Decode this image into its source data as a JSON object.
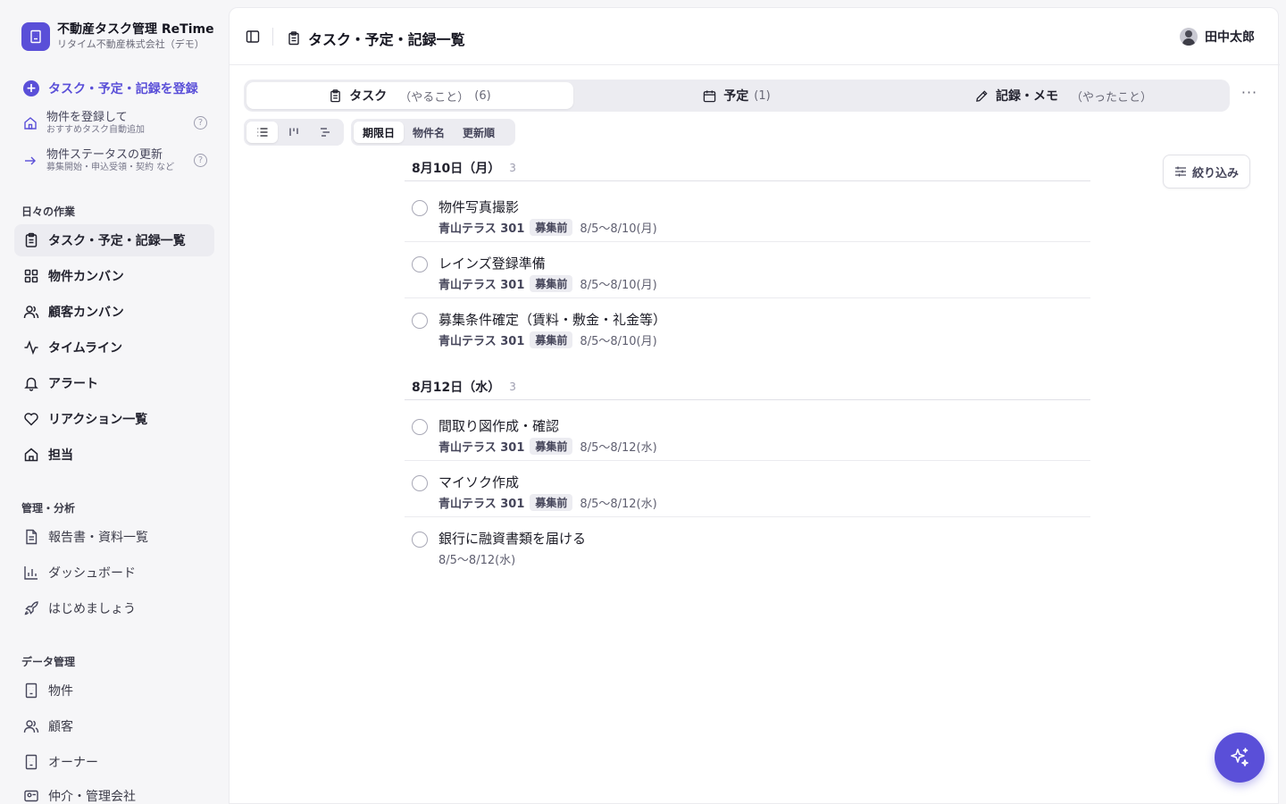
{
  "brand": {
    "title": "不動産タスク管理 ReTime",
    "subtitle": "リタイム不動産株式会社（デモ）"
  },
  "sidebar": {
    "primary_action": "タスク・予定・記録を登録",
    "helpers": [
      {
        "title": "物件を登録して",
        "sub": "おすすめタスク自動追加",
        "help": "?"
      },
      {
        "title": "物件ステータスの更新",
        "sub": "募集開始・申込受領・契約 など",
        "help": "?"
      }
    ],
    "sections": {
      "daily": "日々の作業",
      "admin": "管理・分析",
      "data": "データ管理"
    },
    "daily_items": [
      {
        "label": "タスク・予定・記録一覧",
        "icon": "clipboard-icon",
        "active": true
      },
      {
        "label": "物件カンバン",
        "icon": "grid-icon"
      },
      {
        "label": "顧客カンバン",
        "icon": "users-icon"
      },
      {
        "label": "タイムライン",
        "icon": "activity-icon"
      },
      {
        "label": "アラート",
        "icon": "bell-icon"
      },
      {
        "label": "リアクション一覧",
        "icon": "heart-icon"
      },
      {
        "label": "担当",
        "icon": "home-icon"
      }
    ],
    "admin_items": [
      {
        "label": "報告書・資料一覧",
        "icon": "document-icon"
      },
      {
        "label": "ダッシュボード",
        "icon": "bar-chart-icon"
      },
      {
        "label": "はじめましょう",
        "icon": "rocket-icon"
      }
    ],
    "data_items": [
      {
        "label": "物件",
        "icon": "building-icon"
      },
      {
        "label": "顧客",
        "icon": "users-icon"
      },
      {
        "label": "オーナー",
        "icon": "building-icon"
      },
      {
        "label": "仲介・管理会社",
        "icon": "id-card-icon"
      }
    ]
  },
  "header": {
    "title": "タスク・予定・記録一覧",
    "user": "田中太郎"
  },
  "tabs": [
    {
      "label": "タスク",
      "sub": "（やること）",
      "count": "(6)",
      "icon": "clipboard-icon",
      "active": true
    },
    {
      "label": "予定",
      "count": "(1)",
      "icon": "calendar-icon"
    },
    {
      "label": "記録・メモ",
      "sub": "（やったこと）",
      "icon": "pencil-icon"
    }
  ],
  "more": "···",
  "sort": {
    "options": [
      "期限日",
      "物件名",
      "更新順"
    ],
    "selected": "期限日"
  },
  "filter": {
    "label": "絞り込み"
  },
  "groups": [
    {
      "date": "8月10日（月）",
      "count": "3",
      "tasks": [
        {
          "title": "物件写真撮影",
          "property": "青山テラス 301",
          "status": "募集前",
          "period": "8/5〜8/10(月)"
        },
        {
          "title": "レインズ登録準備",
          "property": "青山テラス 301",
          "status": "募集前",
          "period": "8/5〜8/10(月)"
        },
        {
          "title": "募集条件確定（賃料・敷金・礼金等）",
          "property": "青山テラス 301",
          "status": "募集前",
          "period": "8/5〜8/10(月)"
        }
      ]
    },
    {
      "date": "8月12日（水）",
      "count": "3",
      "tasks": [
        {
          "title": "間取り図作成・確認",
          "property": "青山テラス 301",
          "status": "募集前",
          "period": "8/5〜8/12(水)"
        },
        {
          "title": "マイソク作成",
          "property": "青山テラス 301",
          "status": "募集前",
          "period": "8/5〜8/12(水)"
        },
        {
          "title": "銀行に融資書類を届ける",
          "property": "",
          "status": "",
          "period": "8/5〜8/12(水)"
        }
      ]
    }
  ],
  "colors": {
    "accent": "#5a4fd8",
    "background": "#f6f6f8",
    "panel": "#ffffff"
  }
}
